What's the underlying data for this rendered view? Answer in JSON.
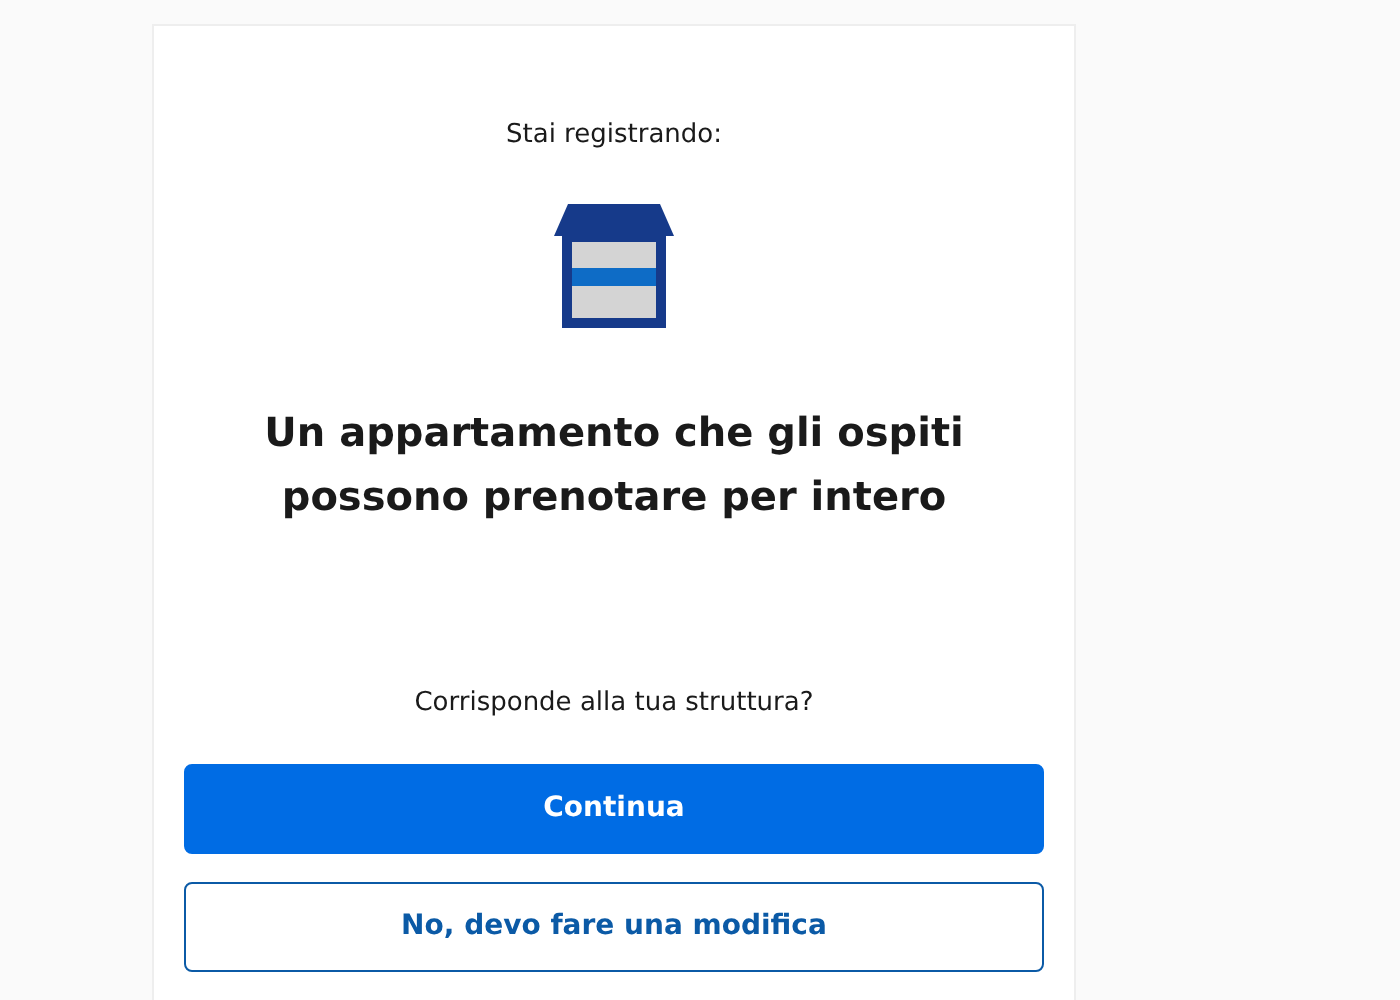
{
  "intro": "Stai registrando:",
  "title": "Un appartamento che gli ospiti possono prenotare per intero",
  "question": "Corrisponde alla tua struttura?",
  "buttons": [
    {
      "label": "Continua",
      "kind": "primary"
    },
    {
      "label": "No, devo fare una modifica",
      "kind": "secondary"
    }
  ]
}
